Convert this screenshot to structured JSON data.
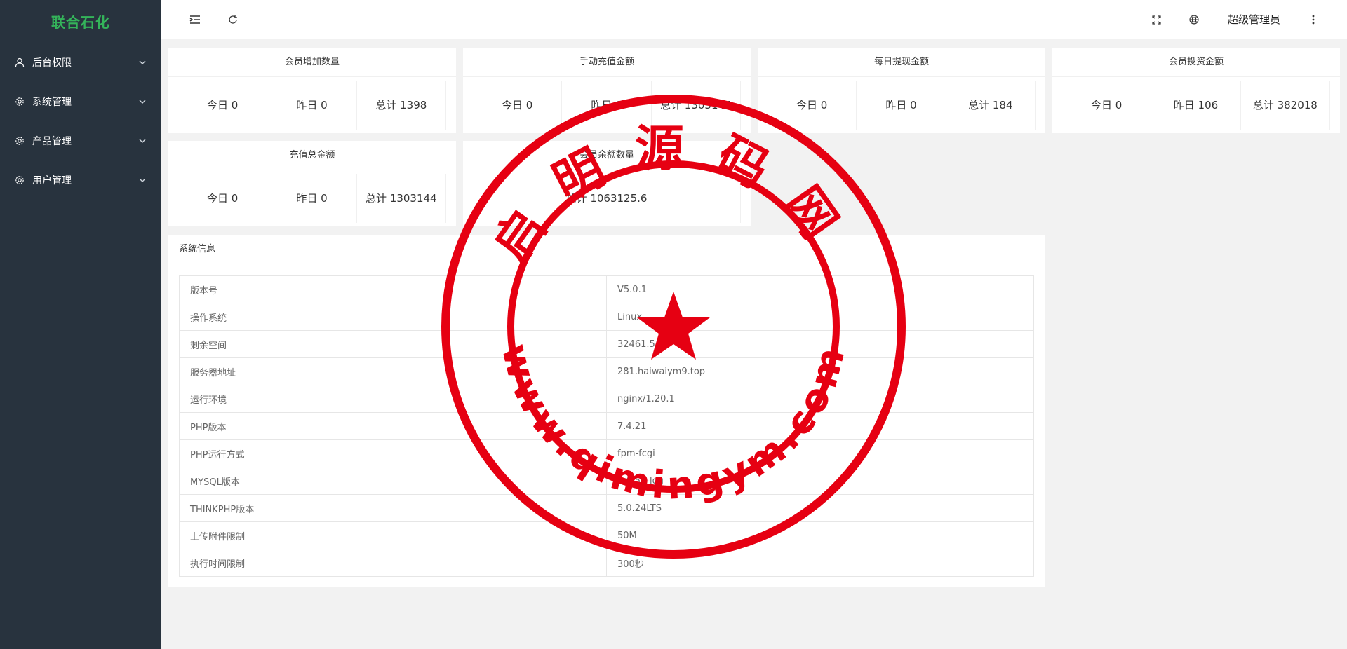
{
  "sidebar": {
    "brand": "联合石化",
    "items": [
      {
        "label": "后台权限",
        "icon": "user-icon"
      },
      {
        "label": "系统管理",
        "icon": "gear-icon"
      },
      {
        "label": "产品管理",
        "icon": "gear-icon"
      },
      {
        "label": "用户管理",
        "icon": "gear-icon"
      }
    ]
  },
  "header": {
    "admin_label": "超级管理员",
    "icons": [
      "menu-toggle-icon",
      "refresh-icon",
      "fullscreen-icon",
      "globe-icon",
      "more-vertical-icon"
    ]
  },
  "cards": [
    {
      "title": "会员增加数量",
      "stats": [
        "今日 0",
        "昨日 0",
        "总计 1398"
      ]
    },
    {
      "title": "手动充值金额",
      "stats": [
        "今日 0",
        "昨日 0",
        "总计 1303144"
      ]
    },
    {
      "title": "每日提现金额",
      "stats": [
        "今日 0",
        "昨日 0",
        "总计 184"
      ]
    },
    {
      "title": "会员投资金额",
      "stats": [
        "今日 0",
        "昨日 106",
        "总计 382018"
      ]
    },
    {
      "title": "充值总金额",
      "stats": [
        "今日 0",
        "昨日 0",
        "总计 1303144"
      ]
    },
    {
      "title": "会员余额数量",
      "stats": [
        "总计 1063125.6"
      ]
    }
  ],
  "system_info": {
    "title": "系统信息",
    "rows": [
      {
        "key": "版本号",
        "value": "V5.0.1"
      },
      {
        "key": "操作系统",
        "value": "Linux"
      },
      {
        "key": "剩余空间",
        "value": "32461.54M"
      },
      {
        "key": "服务器地址",
        "value": "281.haiwaiym9.top"
      },
      {
        "key": "运行环境",
        "value": "nginx/1.20.1"
      },
      {
        "key": "PHP版本",
        "value": "7.4.21"
      },
      {
        "key": "PHP运行方式",
        "value": "fpm-fcgi"
      },
      {
        "key": "MYSQL版本",
        "value": "5.6.50-log"
      },
      {
        "key": "THINKPHP版本",
        "value": "5.0.24LTS"
      },
      {
        "key": "上传附件限制",
        "value": "50M"
      },
      {
        "key": "执行时间限制",
        "value": "300秒"
      }
    ]
  },
  "watermark": {
    "top_text": "启明源码网",
    "bottom_text": "www.qimingym.com",
    "color": "#e60012"
  },
  "colors": {
    "brand": "#34b45a",
    "sidebar_bg": "#28333e"
  }
}
